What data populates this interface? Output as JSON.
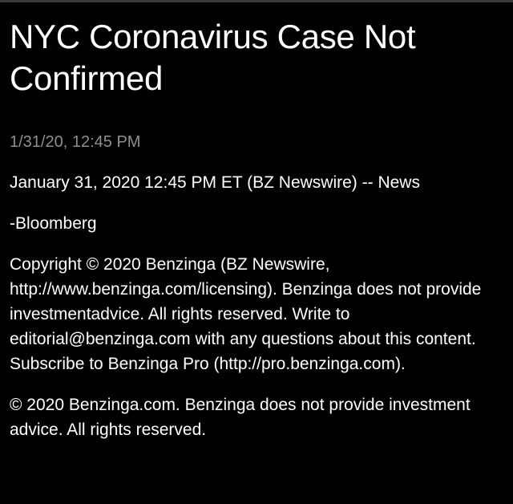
{
  "article": {
    "title": "NYC Coronavirus Case Not Confirmed",
    "timestamp": "1/31/20, 12:45 PM",
    "dateline": "January 31, 2020 12:45 PM ET (BZ Newswire) -- News",
    "source": "-Bloomberg",
    "copyright": "Copyright © 2020 Benzinga (BZ Newswire, http://www.benzinga.com/licensing). Benzinga does not provide investmentadvice. All rights reserved. Write to editorial@benzinga.com with any questions about this content. Subscribe to Benzinga Pro (http://pro.benzinga.com).",
    "footer": "© 2020 Benzinga.com. Benzinga does not provide investment advice. All rights reserved."
  },
  "colors": {
    "background": "#000000",
    "text": "#ffffff",
    "muted": "#8e8e93"
  }
}
